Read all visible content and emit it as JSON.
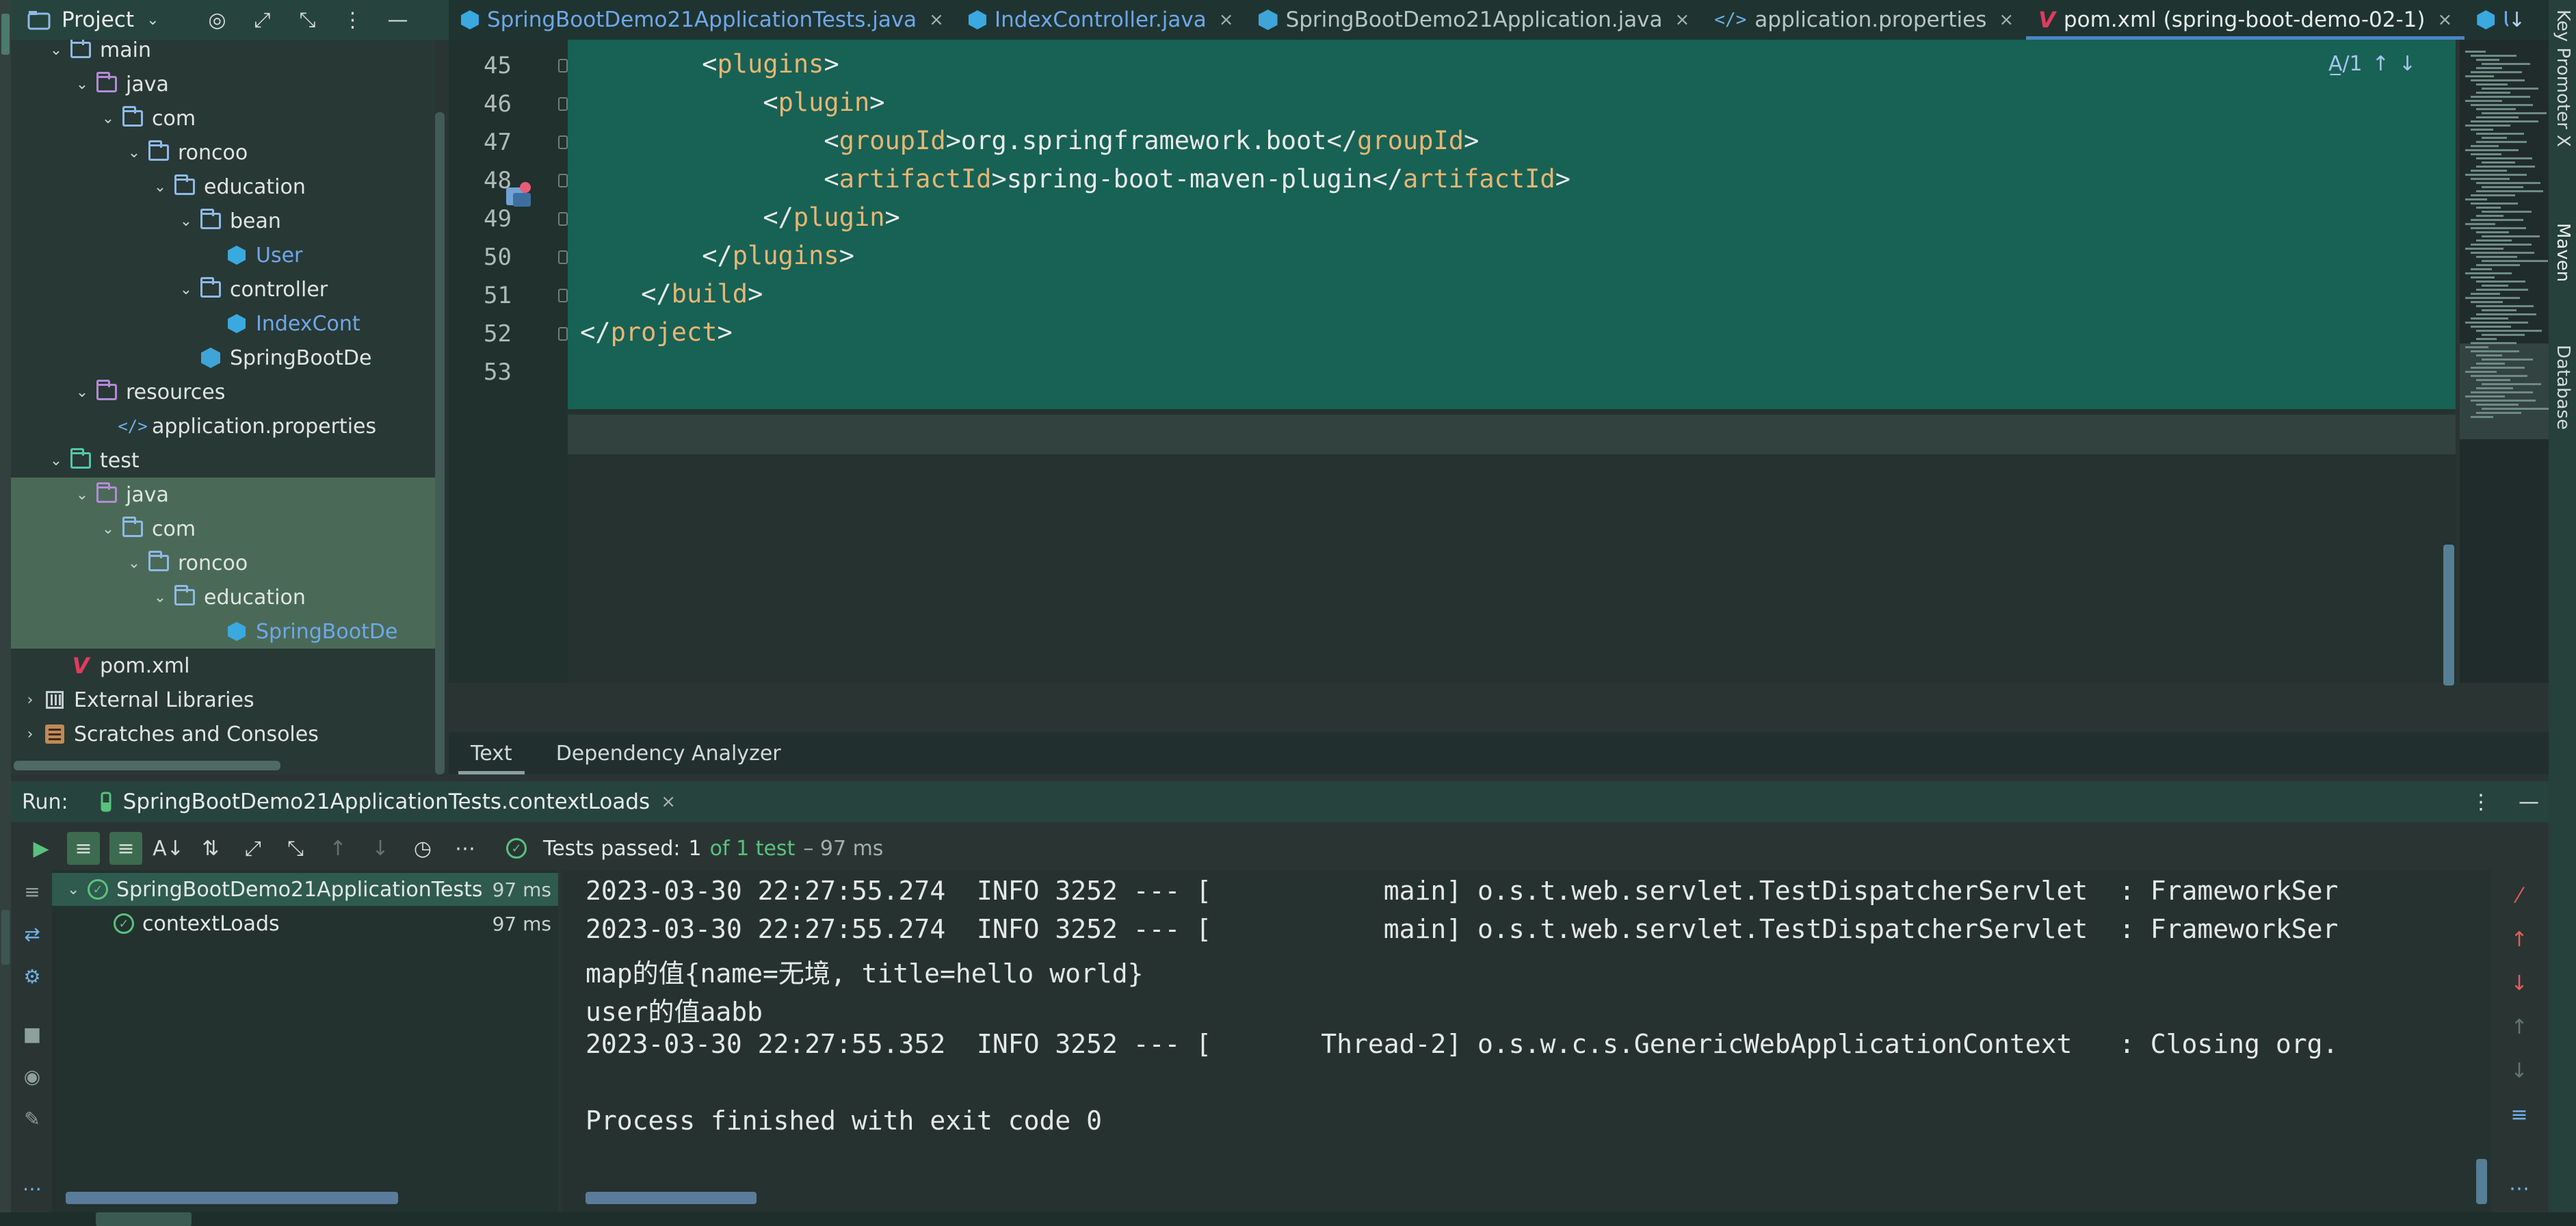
{
  "project_panel": {
    "title": "Project",
    "caret": "⌄",
    "tools": [
      "◎",
      "⤢",
      "⤡",
      "⋮",
      "—"
    ],
    "tree": [
      {
        "label": "main",
        "depth": 1,
        "arrow": "⌄",
        "icon": "folder",
        "selected": false,
        "blue": false
      },
      {
        "label": "java",
        "depth": 2,
        "arrow": "⌄",
        "icon": "src-folder",
        "selected": false,
        "blue": false
      },
      {
        "label": "com",
        "depth": 3,
        "arrow": "⌄",
        "icon": "folder",
        "selected": false,
        "blue": false
      },
      {
        "label": "roncoo",
        "depth": 4,
        "arrow": "⌄",
        "icon": "folder",
        "selected": false,
        "blue": false
      },
      {
        "label": "education",
        "depth": 5,
        "arrow": "⌄",
        "icon": "folder",
        "selected": false,
        "blue": false
      },
      {
        "label": "bean",
        "depth": 6,
        "arrow": "⌄",
        "icon": "folder",
        "selected": false,
        "blue": false
      },
      {
        "label": "User",
        "depth": 7,
        "arrow": "",
        "icon": "class",
        "selected": false,
        "blue": true
      },
      {
        "label": "controller",
        "depth": 6,
        "arrow": "⌄",
        "icon": "folder",
        "selected": false,
        "blue": false
      },
      {
        "label": "IndexCont",
        "depth": 7,
        "arrow": "",
        "icon": "class",
        "selected": false,
        "blue": true
      },
      {
        "label": "SpringBootDe",
        "depth": 6,
        "arrow": "",
        "icon": "boot",
        "selected": false,
        "blue": false
      },
      {
        "label": "resources",
        "depth": 2,
        "arrow": "⌄",
        "icon": "src-folder",
        "selected": false,
        "blue": false
      },
      {
        "label": "application.properties",
        "depth": 3,
        "arrow": "",
        "icon": "xml",
        "selected": false,
        "blue": false
      },
      {
        "label": "test",
        "depth": 1,
        "arrow": "⌄",
        "icon": "test-folder",
        "selected": false,
        "blue": false
      },
      {
        "label": "java",
        "depth": 2,
        "arrow": "⌄",
        "icon": "src-folder",
        "selected": true,
        "blue": false
      },
      {
        "label": "com",
        "depth": 3,
        "arrow": "⌄",
        "icon": "folder",
        "selected": true,
        "blue": false
      },
      {
        "label": "roncoo",
        "depth": 4,
        "arrow": "⌄",
        "icon": "folder",
        "selected": true,
        "blue": false
      },
      {
        "label": "education",
        "depth": 5,
        "arrow": "⌄",
        "icon": "folder",
        "selected": true,
        "blue": false
      },
      {
        "label": "SpringBootDe",
        "depth": 7,
        "arrow": "",
        "icon": "class",
        "selected": true,
        "blue": true
      },
      {
        "label": "pom.xml",
        "depth": 1,
        "arrow": "",
        "icon": "maven",
        "selected": false,
        "blue": false
      },
      {
        "label": "External Libraries",
        "depth": 0,
        "arrow": "›",
        "icon": "lib",
        "selected": false,
        "blue": false
      },
      {
        "label": "Scratches and Consoles",
        "depth": 0,
        "arrow": "›",
        "icon": "scratch",
        "selected": false,
        "blue": false
      }
    ]
  },
  "editor_tabs": [
    {
      "label": "SpringBootDemo21ApplicationTests.java",
      "icon": "class",
      "active": false,
      "closable": true,
      "blue": true
    },
    {
      "label": "IndexController.java",
      "icon": "class",
      "active": false,
      "closable": true,
      "blue": true
    },
    {
      "label": "SpringBootDemo21Application.java",
      "icon": "boot",
      "active": false,
      "closable": true,
      "blue": false
    },
    {
      "label": "application.properties",
      "icon": "xml",
      "active": false,
      "closable": true,
      "blue": false
    },
    {
      "label": "pom.xml (spring-boot-demo-02-1)",
      "icon": "maven",
      "active": true,
      "closable": true,
      "blue": false
    },
    {
      "label": "U",
      "icon": "class",
      "active": false,
      "closable": false,
      "blue": true
    }
  ],
  "tabs_right": [
    "↓",
    "⋮"
  ],
  "editor": {
    "lines": [
      {
        "num": "45",
        "indent": "        ",
        "parts": [
          [
            "br",
            "<"
          ],
          [
            "tag",
            "plugins"
          ],
          [
            "br",
            ">"
          ]
        ]
      },
      {
        "num": "46",
        "indent": "            ",
        "parts": [
          [
            "br",
            "<"
          ],
          [
            "tag",
            "plugin"
          ],
          [
            "br",
            ">"
          ]
        ]
      },
      {
        "num": "47",
        "indent": "                ",
        "parts": [
          [
            "br",
            "<"
          ],
          [
            "tag",
            "groupId"
          ],
          [
            "br",
            ">"
          ],
          [
            "txt",
            "org.springframework.boot"
          ],
          [
            "br",
            "</"
          ],
          [
            "tag",
            "groupId"
          ],
          [
            "br",
            ">"
          ]
        ]
      },
      {
        "num": "48",
        "indent": "                ",
        "parts": [
          [
            "br",
            "<"
          ],
          [
            "tag",
            "artifactId"
          ],
          [
            "br",
            ">"
          ],
          [
            "txt",
            "spring-boot-maven-plugin"
          ],
          [
            "br",
            "</"
          ],
          [
            "tag",
            "artifactId"
          ],
          [
            "br",
            ">"
          ]
        ]
      },
      {
        "num": "49",
        "indent": "            ",
        "parts": [
          [
            "br",
            "</"
          ],
          [
            "tag",
            "plugin"
          ],
          [
            "br",
            ">"
          ]
        ]
      },
      {
        "num": "50",
        "indent": "        ",
        "parts": [
          [
            "br",
            "</"
          ],
          [
            "tag",
            "plugins"
          ],
          [
            "br",
            ">"
          ]
        ]
      },
      {
        "num": "51",
        "indent": "    ",
        "parts": [
          [
            "br",
            "</"
          ],
          [
            "tag",
            "build"
          ],
          [
            "br",
            ">"
          ]
        ]
      },
      {
        "num": "52",
        "indent": "",
        "parts": [
          [
            "br",
            "</"
          ],
          [
            "tag",
            "project"
          ],
          [
            "br",
            ">"
          ]
        ]
      },
      {
        "num": "53",
        "indent": "",
        "parts": []
      }
    ],
    "inspection": {
      "label": "A̲/1",
      "up": "↑",
      "down": "↓"
    }
  },
  "editor_bottom_tabs": [
    "Text",
    "Dependency Analyzer"
  ],
  "right_strip": [
    "Key Promoter X",
    "Maven",
    "Database"
  ],
  "run": {
    "label": "Run:",
    "tab_title": "SpringBootDemo21ApplicationTests.contextLoads",
    "close": "×",
    "header_right": [
      "⋮",
      "—"
    ],
    "tests_passed_label": "Tests passed:",
    "tests_passed_count": "1",
    "tests_passed_of": "of 1 test",
    "tests_passed_time": "– 97 ms",
    "tree": [
      {
        "label": "SpringBootDemo21ApplicationTests",
        "duration": "97 ms",
        "depth": 0,
        "arrow": "⌄"
      },
      {
        "label": "contextLoads",
        "duration": "97 ms",
        "depth": 1,
        "arrow": ""
      }
    ],
    "console": [
      "2023-03-30 22:27:55.274  INFO 3252 --- [           main] o.s.t.web.servlet.TestDispatcherServlet  : FrameworkSer",
      "2023-03-30 22:27:55.274  INFO 3252 --- [           main] o.s.t.web.servlet.TestDispatcherServlet  : FrameworkSer",
      "map的值{name=无境, title=hello world}",
      "user的值aabb",
      "2023-03-30 22:27:55.352  INFO 3252 --- [       Thread-2] o.s.w.c.s.GenericWebApplicationContext   : Closing org.",
      "",
      "Process finished with exit code 0"
    ]
  },
  "colors": {
    "accent_tab": "#4a86c8",
    "pass_green": "#59c27c",
    "xml_tag": "#e6b673",
    "maven_red": "#e23a5f"
  }
}
